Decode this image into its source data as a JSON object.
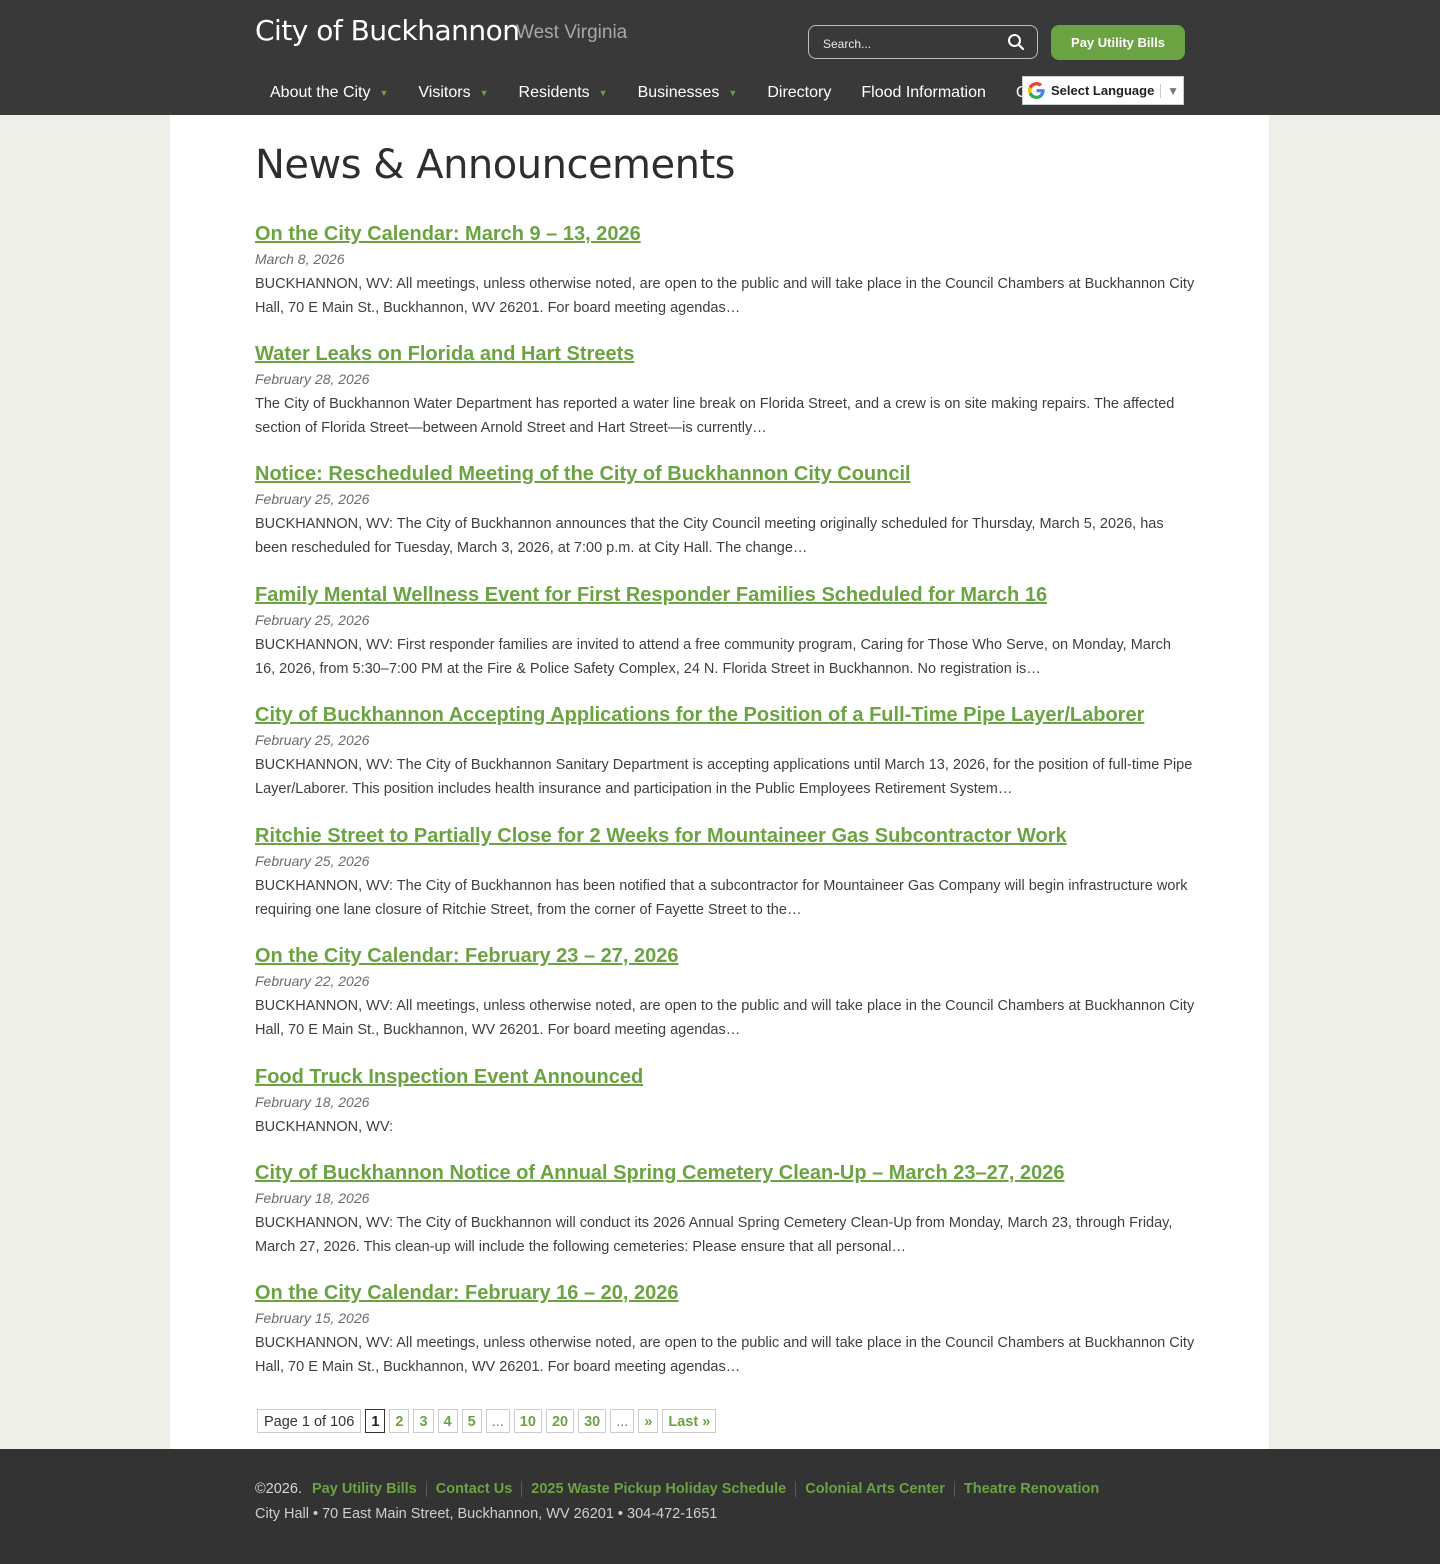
{
  "header": {
    "site_title": "City of Buckhannon",
    "site_subtitle": "West Virginia",
    "search_placeholder": "Search...",
    "pay_button": "Pay Utility Bills",
    "language_label": "Select Language",
    "nav": [
      {
        "label": "About the City",
        "has_submenu": true
      },
      {
        "label": "Visitors",
        "has_submenu": true
      },
      {
        "label": "Residents",
        "has_submenu": true
      },
      {
        "label": "Businesses",
        "has_submenu": true
      },
      {
        "label": "Directory",
        "has_submenu": false
      },
      {
        "label": "Flood Information",
        "has_submenu": false
      },
      {
        "label": "Contact Us",
        "has_submenu": false
      }
    ]
  },
  "main": {
    "page_title": "News & Announcements",
    "posts": [
      {
        "title": "On the City Calendar: March 9 – 13, 2026",
        "date": "March 8, 2026",
        "excerpt": "BUCKHANNON, WV: All meetings, unless otherwise noted, are open to the public and will take place in the Council Chambers at Buckhannon City Hall, 70 E Main St., Buckhannon, WV 26201. For board meeting agendas…"
      },
      {
        "title": "Water Leaks on Florida and Hart Streets",
        "date": "February 28, 2026",
        "excerpt": "The City of Buckhannon Water Department has reported a water line break on Florida Street, and a crew is on site making repairs. The affected section of Florida Street—between Arnold Street and Hart Street—is currently…"
      },
      {
        "title": "Notice: Rescheduled Meeting of the City of Buckhannon City Council",
        "date": "February 25, 2026",
        "excerpt": "BUCKHANNON, WV: The City of Buckhannon announces that the City Council meeting originally scheduled for Thursday, March 5, 2026, has been rescheduled for Tuesday, March 3, 2026, at 7:00 p.m. at City Hall. The change…"
      },
      {
        "title": "Family Mental Wellness Event for First Responder Families Scheduled for March 16",
        "date": "February 25, 2026",
        "excerpt": "BUCKHANNON, WV: First responder families are invited to attend a free community program, Caring for Those Who Serve, on Monday, March 16, 2026, from 5:30–7:00 PM at the Fire & Police Safety Complex, 24 N. Florida Street in Buckhannon. No registration is…"
      },
      {
        "title": "City of Buckhannon Accepting Applications for the Position of a Full-Time Pipe Layer/Laborer",
        "date": "February 25, 2026",
        "excerpt": "BUCKHANNON, WV: The City of Buckhannon Sanitary Department is accepting applications until March 13, 2026, for the position of full-time Pipe Layer/Laborer. This position includes health insurance and participation in the Public Employees Retirement System…"
      },
      {
        "title": "Ritchie Street to Partially Close for 2 Weeks for Mountaineer Gas Subcontractor Work",
        "date": "February 25, 2026",
        "excerpt": "BUCKHANNON, WV: The City of Buckhannon has been notified that a subcontractor for Mountaineer Gas Company will begin infrastructure work requiring one lane closure of Ritchie Street, from the corner of Fayette Street to the…"
      },
      {
        "title": "On the City Calendar: February 23 – 27, 2026",
        "date": "February 22, 2026",
        "excerpt": "BUCKHANNON, WV: All meetings, unless otherwise noted, are open to the public and will take place in the Council Chambers at Buckhannon City Hall, 70 E Main St., Buckhannon, WV 26201. For board meeting agendas…"
      },
      {
        "title": "Food Truck Inspection Event Announced",
        "date": "February 18, 2026",
        "excerpt": "BUCKHANNON, WV:"
      },
      {
        "title": "City of Buckhannon Notice of Annual Spring Cemetery Clean-Up – March 23–27, 2026",
        "date": "February 18, 2026",
        "excerpt": "BUCKHANNON, WV: The City of Buckhannon will conduct its 2026 Annual Spring Cemetery Clean-Up from Monday, March 23, through Friday, March 27, 2026. This clean-up will include the following cemeteries: Please ensure that all personal…"
      },
      {
        "title": "On the City Calendar: February 16 – 20, 2026",
        "date": "February 15, 2026",
        "excerpt": "BUCKHANNON, WV: All meetings, unless otherwise noted, are open to the public and will take place in the Council Chambers at Buckhannon City Hall, 70 E Main St., Buckhannon, WV 26201. For board meeting agendas…"
      }
    ],
    "pagination": {
      "info": "Page 1 of 106",
      "pages": [
        {
          "label": "1",
          "type": "current"
        },
        {
          "label": "2",
          "type": "link"
        },
        {
          "label": "3",
          "type": "link"
        },
        {
          "label": "4",
          "type": "link"
        },
        {
          "label": "5",
          "type": "link"
        },
        {
          "label": "...",
          "type": "dots"
        },
        {
          "label": "10",
          "type": "link"
        },
        {
          "label": "20",
          "type": "link"
        },
        {
          "label": "30",
          "type": "link"
        },
        {
          "label": "...",
          "type": "dots"
        },
        {
          "label": "»",
          "type": "link"
        },
        {
          "label": "Last »",
          "type": "link"
        }
      ]
    }
  },
  "footer": {
    "copyright": "©2026.",
    "links": [
      "Pay Utility Bills",
      "Contact Us",
      "2025 Waste Pickup Holiday Schedule",
      "Colonial Arts Center",
      "Theatre Renovation"
    ],
    "address": "City Hall • 70 East Main Street, Buckhannon, WV 26201 • 304-472-1651"
  },
  "colors": {
    "header_bg": "#393939",
    "accent_green": "#6ba343",
    "footer_bg": "#333333",
    "page_bg": "#efefe9"
  }
}
